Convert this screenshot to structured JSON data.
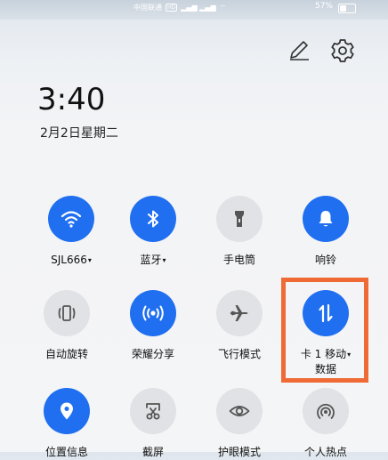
{
  "statusbar": {
    "carrier": "中国联通",
    "hd": "HD",
    "battery_percent": "57%",
    "battery_level": 0.57
  },
  "clock": {
    "time": "3:40",
    "date": "2月2日星期二"
  },
  "header_icons": [
    "edit-icon",
    "settings-gear-icon"
  ],
  "tiles": [
    {
      "label": "SJL666",
      "dropdown": true,
      "icon": "wifi-icon",
      "active": true
    },
    {
      "label": "蓝牙",
      "dropdown": true,
      "icon": "bluetooth-icon",
      "active": true
    },
    {
      "label": "手电筒",
      "dropdown": false,
      "icon": "flashlight-icon",
      "active": false
    },
    {
      "label": "响铃",
      "dropdown": false,
      "icon": "bell-icon",
      "active": true
    },
    {
      "label": "自动旋转",
      "dropdown": false,
      "icon": "auto-rotate-icon",
      "active": false
    },
    {
      "label": "荣耀分享",
      "dropdown": false,
      "icon": "share-icon",
      "active": true
    },
    {
      "label": "飞行模式",
      "dropdown": false,
      "icon": "airplane-icon",
      "active": false
    },
    {
      "label": "卡 1 移动",
      "label2": "数据",
      "dropdown": true,
      "icon": "mobile-data-icon",
      "active": true
    },
    {
      "label": "位置信息",
      "dropdown": false,
      "icon": "location-icon",
      "active": true
    },
    {
      "label": "截屏",
      "dropdown": false,
      "icon": "screenshot-icon",
      "active": false
    },
    {
      "label": "护眼模式",
      "dropdown": false,
      "icon": "eye-icon",
      "active": false
    },
    {
      "label": "个人热点",
      "dropdown": false,
      "icon": "hotspot-icon",
      "active": false
    }
  ],
  "caret": "▾",
  "colors": {
    "active": "#1f6ff0",
    "inactive": "#e1e2e5",
    "highlight": "#f06a35"
  }
}
